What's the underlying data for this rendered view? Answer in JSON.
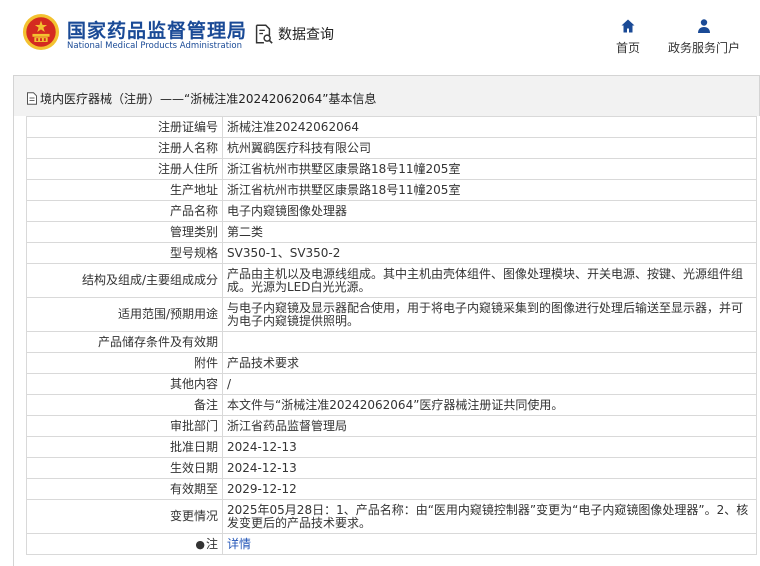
{
  "header": {
    "site_title_cn": "国家药品监督管理局",
    "site_title_en": "National Medical Products Administration",
    "search_label": "数据查询",
    "nav": [
      {
        "label": "首页",
        "icon": "home-icon"
      },
      {
        "label": "政务服务门户",
        "icon": "user-icon"
      }
    ]
  },
  "breadcrumb": {
    "category": "境内医疗器械（注册）",
    "separator": " —— ",
    "current": "“浙械注准20242062064”基本信息"
  },
  "colors": {
    "brand_blue": "#1a4a96",
    "emblem_red": "#d42a20",
    "emblem_gold": "#f3c230",
    "link_blue": "#2356b8",
    "border": "#d9d9d9"
  },
  "record": {
    "rows": [
      {
        "label": "注册证编号",
        "value": "浙械注准20242062064"
      },
      {
        "label": "注册人名称",
        "value": "杭州翼鹞医疗科技有限公司"
      },
      {
        "label": "注册人住所",
        "value": "浙江省杭州市拱墅区康景路18号11幢205室"
      },
      {
        "label": "生产地址",
        "value": "浙江省杭州市拱墅区康景路18号11幢205室"
      },
      {
        "label": "产品名称",
        "value": "电子内窥镜图像处理器"
      },
      {
        "label": "管理类别",
        "value": "第二类"
      },
      {
        "label": "型号规格",
        "value": "SV350-1、SV350-2"
      },
      {
        "label": "结构及组成/主要组成成分",
        "value": "产品由主机以及电源线组成。其中主机由壳体组件、图像处理模块、开关电源、按键、光源组件组成。光源为LED白光光源。"
      },
      {
        "label": "适用范围/预期用途",
        "value": "与电子内窥镜及显示器配合使用，用于将电子内窥镜采集到的图像进行处理后输送至显示器，并可为电子内窥镜提供照明。"
      },
      {
        "label": "产品储存条件及有效期",
        "value": ""
      },
      {
        "label": "附件",
        "value": "产品技术要求"
      },
      {
        "label": "其他内容",
        "value": "/"
      },
      {
        "label": "备注",
        "value": "本文件与“浙械注准20242062064”医疗器械注册证共同使用。"
      },
      {
        "label": "审批部门",
        "value": "浙江省药品监督管理局"
      },
      {
        "label": "批准日期",
        "value": "2024-12-13"
      },
      {
        "label": "生效日期",
        "value": "2024-12-13"
      },
      {
        "label": "有效期至",
        "value": "2029-12-12"
      },
      {
        "label": "变更情况",
        "value": "2025年05月28日：1、产品名称：由“医用内窥镜控制器”变更为“电子内窥镜图像处理器”。2、核发变更后的产品技术要求。"
      }
    ],
    "note_label": "注",
    "note_icon": "pin-icon",
    "detail_link": "详情"
  }
}
